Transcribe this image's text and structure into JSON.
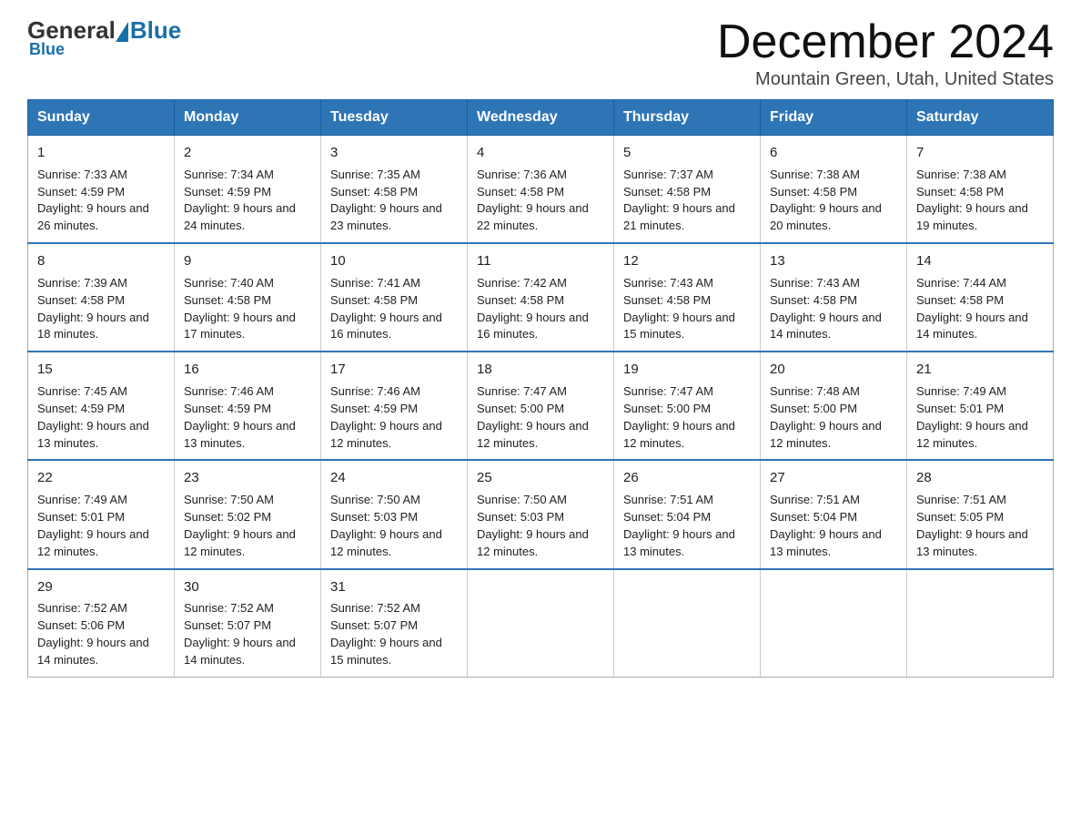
{
  "header": {
    "logo_general": "General",
    "logo_blue": "Blue",
    "month_title": "December 2024",
    "location": "Mountain Green, Utah, United States"
  },
  "weekdays": [
    "Sunday",
    "Monday",
    "Tuesday",
    "Wednesday",
    "Thursday",
    "Friday",
    "Saturday"
  ],
  "weeks": [
    [
      {
        "day": "1",
        "sunrise": "7:33 AM",
        "sunset": "4:59 PM",
        "daylight": "9 hours and 26 minutes."
      },
      {
        "day": "2",
        "sunrise": "7:34 AM",
        "sunset": "4:59 PM",
        "daylight": "9 hours and 24 minutes."
      },
      {
        "day": "3",
        "sunrise": "7:35 AM",
        "sunset": "4:58 PM",
        "daylight": "9 hours and 23 minutes."
      },
      {
        "day": "4",
        "sunrise": "7:36 AM",
        "sunset": "4:58 PM",
        "daylight": "9 hours and 22 minutes."
      },
      {
        "day": "5",
        "sunrise": "7:37 AM",
        "sunset": "4:58 PM",
        "daylight": "9 hours and 21 minutes."
      },
      {
        "day": "6",
        "sunrise": "7:38 AM",
        "sunset": "4:58 PM",
        "daylight": "9 hours and 20 minutes."
      },
      {
        "day": "7",
        "sunrise": "7:38 AM",
        "sunset": "4:58 PM",
        "daylight": "9 hours and 19 minutes."
      }
    ],
    [
      {
        "day": "8",
        "sunrise": "7:39 AM",
        "sunset": "4:58 PM",
        "daylight": "9 hours and 18 minutes."
      },
      {
        "day": "9",
        "sunrise": "7:40 AM",
        "sunset": "4:58 PM",
        "daylight": "9 hours and 17 minutes."
      },
      {
        "day": "10",
        "sunrise": "7:41 AM",
        "sunset": "4:58 PM",
        "daylight": "9 hours and 16 minutes."
      },
      {
        "day": "11",
        "sunrise": "7:42 AM",
        "sunset": "4:58 PM",
        "daylight": "9 hours and 16 minutes."
      },
      {
        "day": "12",
        "sunrise": "7:43 AM",
        "sunset": "4:58 PM",
        "daylight": "9 hours and 15 minutes."
      },
      {
        "day": "13",
        "sunrise": "7:43 AM",
        "sunset": "4:58 PM",
        "daylight": "9 hours and 14 minutes."
      },
      {
        "day": "14",
        "sunrise": "7:44 AM",
        "sunset": "4:58 PM",
        "daylight": "9 hours and 14 minutes."
      }
    ],
    [
      {
        "day": "15",
        "sunrise": "7:45 AM",
        "sunset": "4:59 PM",
        "daylight": "9 hours and 13 minutes."
      },
      {
        "day": "16",
        "sunrise": "7:46 AM",
        "sunset": "4:59 PM",
        "daylight": "9 hours and 13 minutes."
      },
      {
        "day": "17",
        "sunrise": "7:46 AM",
        "sunset": "4:59 PM",
        "daylight": "9 hours and 12 minutes."
      },
      {
        "day": "18",
        "sunrise": "7:47 AM",
        "sunset": "5:00 PM",
        "daylight": "9 hours and 12 minutes."
      },
      {
        "day": "19",
        "sunrise": "7:47 AM",
        "sunset": "5:00 PM",
        "daylight": "9 hours and 12 minutes."
      },
      {
        "day": "20",
        "sunrise": "7:48 AM",
        "sunset": "5:00 PM",
        "daylight": "9 hours and 12 minutes."
      },
      {
        "day": "21",
        "sunrise": "7:49 AM",
        "sunset": "5:01 PM",
        "daylight": "9 hours and 12 minutes."
      }
    ],
    [
      {
        "day": "22",
        "sunrise": "7:49 AM",
        "sunset": "5:01 PM",
        "daylight": "9 hours and 12 minutes."
      },
      {
        "day": "23",
        "sunrise": "7:50 AM",
        "sunset": "5:02 PM",
        "daylight": "9 hours and 12 minutes."
      },
      {
        "day": "24",
        "sunrise": "7:50 AM",
        "sunset": "5:03 PM",
        "daylight": "9 hours and 12 minutes."
      },
      {
        "day": "25",
        "sunrise": "7:50 AM",
        "sunset": "5:03 PM",
        "daylight": "9 hours and 12 minutes."
      },
      {
        "day": "26",
        "sunrise": "7:51 AM",
        "sunset": "5:04 PM",
        "daylight": "9 hours and 13 minutes."
      },
      {
        "day": "27",
        "sunrise": "7:51 AM",
        "sunset": "5:04 PM",
        "daylight": "9 hours and 13 minutes."
      },
      {
        "day": "28",
        "sunrise": "7:51 AM",
        "sunset": "5:05 PM",
        "daylight": "9 hours and 13 minutes."
      }
    ],
    [
      {
        "day": "29",
        "sunrise": "7:52 AM",
        "sunset": "5:06 PM",
        "daylight": "9 hours and 14 minutes."
      },
      {
        "day": "30",
        "sunrise": "7:52 AM",
        "sunset": "5:07 PM",
        "daylight": "9 hours and 14 minutes."
      },
      {
        "day": "31",
        "sunrise": "7:52 AM",
        "sunset": "5:07 PM",
        "daylight": "9 hours and 15 minutes."
      },
      null,
      null,
      null,
      null
    ]
  ],
  "labels": {
    "sunrise_prefix": "Sunrise: ",
    "sunset_prefix": "Sunset: ",
    "daylight_prefix": "Daylight: "
  }
}
